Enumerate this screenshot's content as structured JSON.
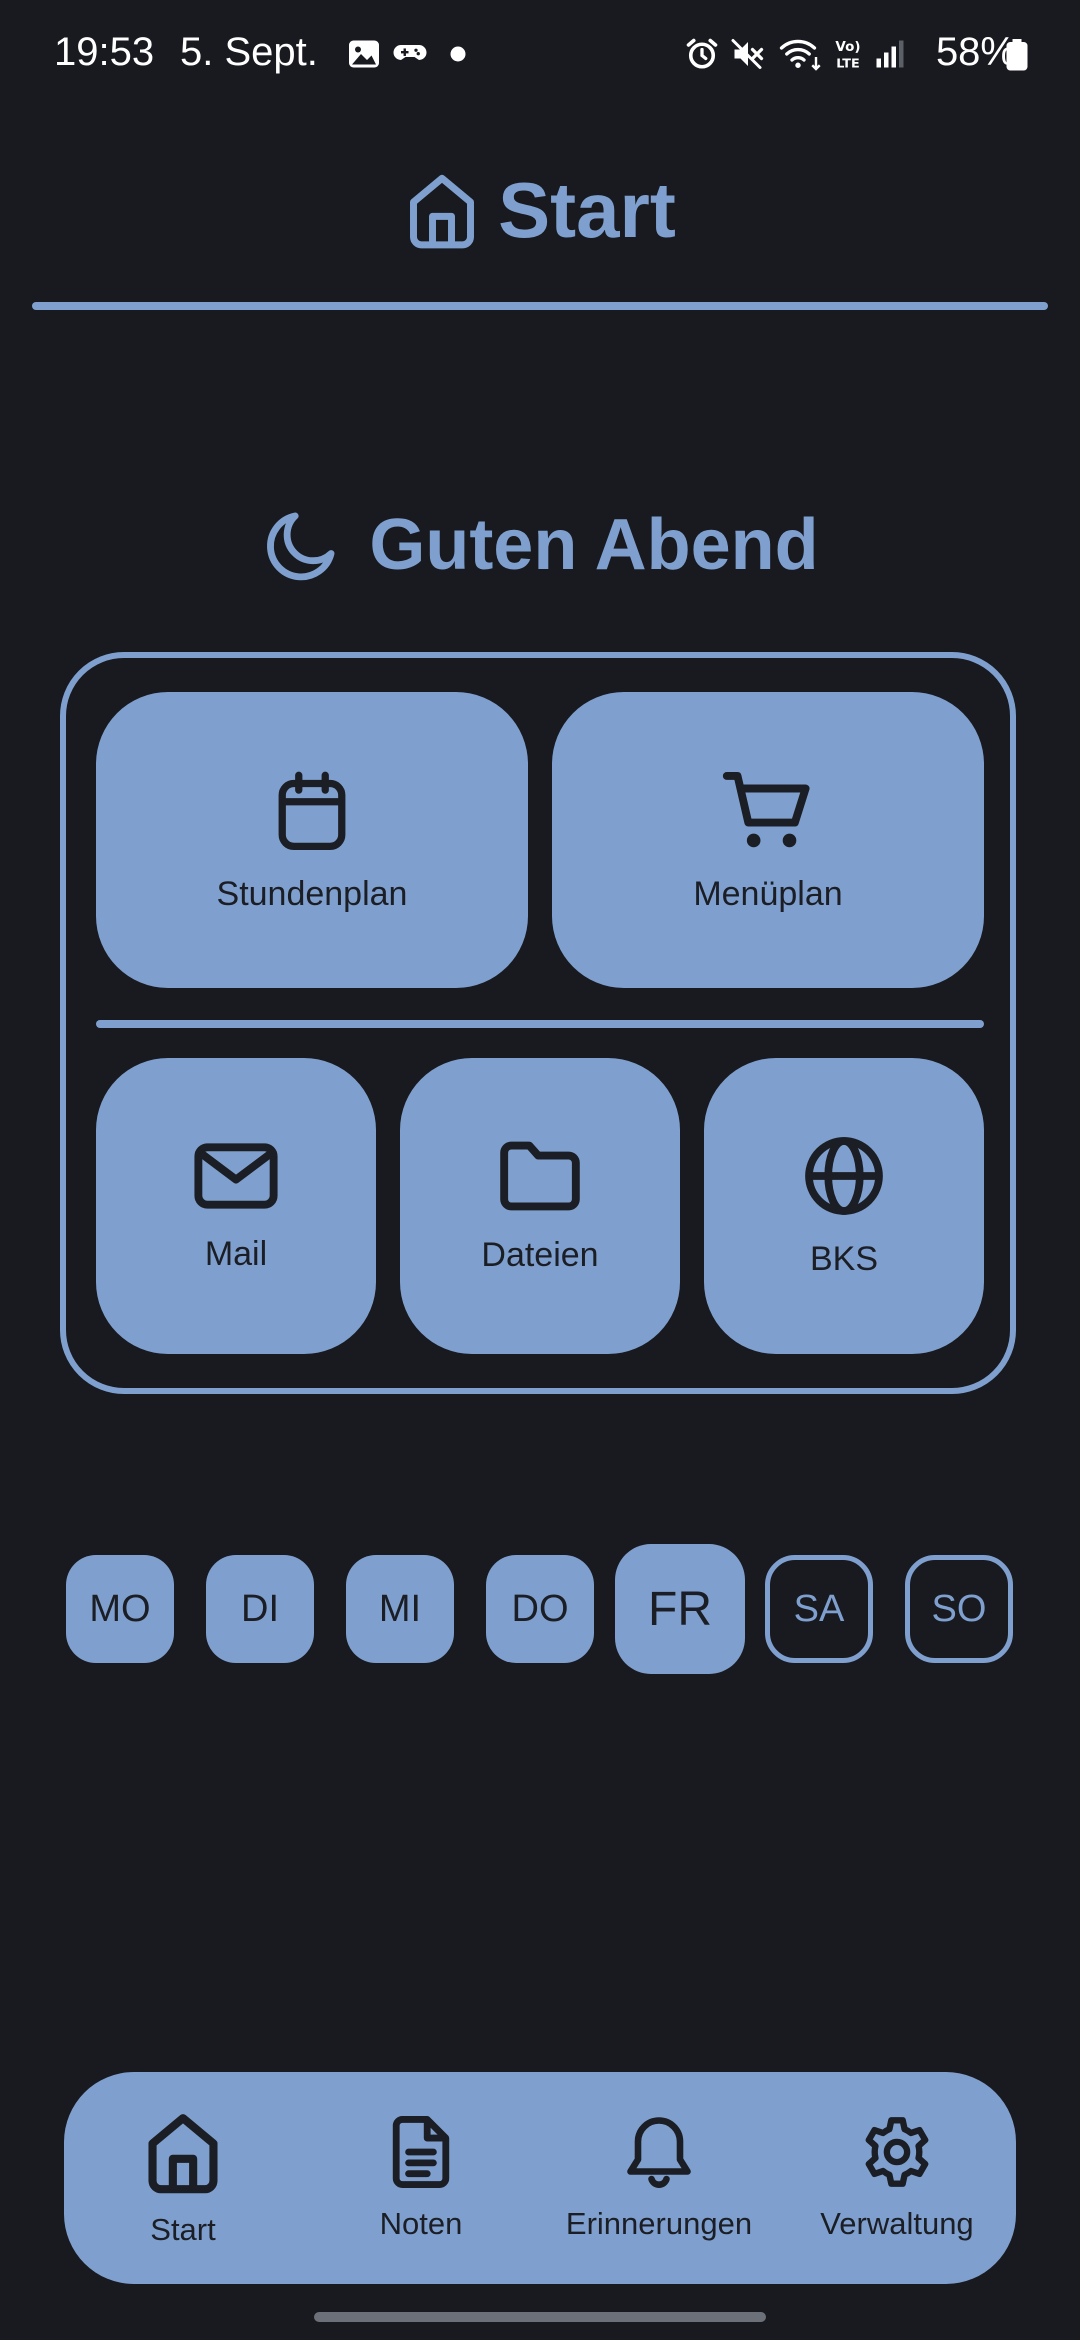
{
  "status_bar": {
    "time": "19:53",
    "date": "5. Sept.",
    "battery": "58%",
    "icons": [
      "image-icon",
      "game-controller-icon",
      "notification-dot-icon",
      "alarm-icon",
      "mute-icon",
      "wifi-icon",
      "volte-icon",
      "signal-icon",
      "battery-icon"
    ]
  },
  "header": {
    "title": "Start",
    "icon": "home-icon"
  },
  "greeting": {
    "text": "Guten Abend",
    "icon": "moon-icon"
  },
  "quick_access": {
    "top_row": [
      {
        "label": "Stundenplan",
        "icon": "calendar-icon"
      },
      {
        "label": "Menüplan",
        "icon": "cart-icon"
      }
    ],
    "bottom_row": [
      {
        "label": "Mail",
        "icon": "mail-icon"
      },
      {
        "label": "Dateien",
        "icon": "folder-icon"
      },
      {
        "label": "BKS",
        "icon": "globe-icon"
      }
    ]
  },
  "weekdays": {
    "days": [
      "MO",
      "DI",
      "MI",
      "DO",
      "FR",
      "SA",
      "SO"
    ],
    "selected": "FR"
  },
  "bottom_nav": {
    "items": [
      {
        "label": "Start",
        "icon": "home-icon"
      },
      {
        "label": "Noten",
        "icon": "document-icon"
      },
      {
        "label": "Erinnerungen",
        "icon": "bell-icon"
      },
      {
        "label": "Verwaltung",
        "icon": "gear-icon"
      }
    ]
  },
  "colors": {
    "background": "#181a20",
    "accent": "#7fa0ce",
    "on_accent": "#1b1e25",
    "status_text": "#ffffff"
  }
}
